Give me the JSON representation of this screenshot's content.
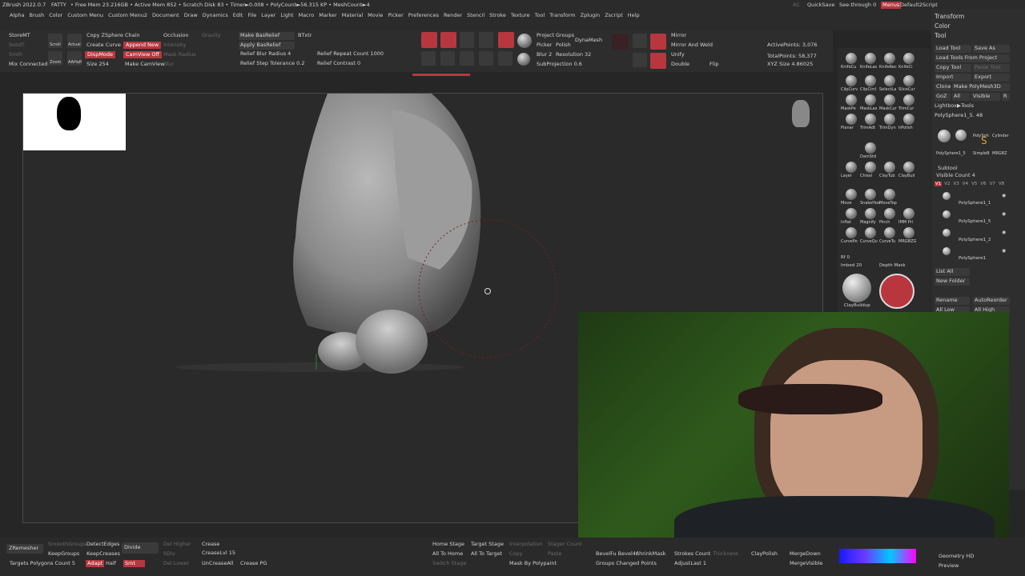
{
  "status": {
    "app_title": "ZBrush 2022.0.7",
    "doc": "FATTY",
    "stats": "• Free Mem 23.216GB • Active Mem 852 • Scratch Disk 83 • Timer►0.008 • PolyCount►56.315 KP • MeshCount►4",
    "ac": "AC",
    "quicksave": "QuickSave",
    "seethrough": "See-through 0",
    "menus_btn": "Menus",
    "script": "Default2Script"
  },
  "menus": [
    "Alpha",
    "Brush",
    "Color",
    "Custom Menu",
    "Custom Menu2",
    "Document",
    "Draw",
    "Dynamics",
    "Edit",
    "File",
    "Layer",
    "Light",
    "Macro",
    "Marker",
    "Material",
    "Movie",
    "Picker",
    "Preferences",
    "Render",
    "Stencil",
    "Stroke",
    "Texture",
    "Tool",
    "Transform",
    "Zplugin",
    "Zscript",
    "Help"
  ],
  "top_left": {
    "store_mt": "StoreMT",
    "solo": "SolidT",
    "smooth": "Smth",
    "mix": "Mix Connected I",
    "scroll": "Scroll",
    "actual": "Actual",
    "zoom": "Zoom",
    "aahalf": "AAHalf",
    "copy_chain": "Copy ZSphere Chain",
    "create_curve": "Create Curve",
    "dispmode": "DispMode",
    "size": "Size 254",
    "append_new": "Append New",
    "camview": "CamView Off",
    "make_camview": "Make CamView",
    "occlusion": "Occlusion",
    "intensity": "Intensity",
    "mask_radius": "Mask Radius",
    "blur": "Blur",
    "gravity": "Gravity"
  },
  "relief": {
    "make_basrelief": "Make BasRelief",
    "btxtr": "BTxtr",
    "apply_basrelief": "Apply BasRelief",
    "blur_radius": "Relief Blur Radius 4",
    "step_tolerance": "Relief Step Tolerance 0.2",
    "repeat_count": "Relief Repeat Count 1000",
    "contrast": "Relief Contrast 0"
  },
  "draw_tools": {
    "remesh_all": "Remesh All",
    "bpr": "BPR",
    "edit": "Edit",
    "draw": "Draw",
    "move": "Move",
    "scale": "Scale",
    "rotate": "Rotate",
    "line_fill": "Line Fill",
    "polyf": "PolyF",
    "transp": "Transp",
    "lsym": "L.Sym",
    "project": "Project",
    "groups": "Groups",
    "picker": "Picker",
    "polish": "Polish",
    "blur": "Blur 2",
    "resolution": "Resolution 32",
    "subprojection": "SubProjection 0.6",
    "dynamesh": "DynaMesh",
    "mirror": "Mirror",
    "mirror_weld": "Mirror And Weld",
    "unify": "Unify",
    "double": "Double",
    "flip": "Flip",
    "active_points": "ActivePoints: 3,076",
    "total_points": "TotalPoints: 58,377",
    "xyz_size": "XYZ Size 4.86025"
  },
  "brushes": {
    "row1": [
      "KnifeCu",
      "KnifeLas",
      "KnifeRec",
      "KnifeCi"
    ],
    "row2": [
      "ClipCurv",
      "ClipCircl",
      "SelectLa",
      "SliceCur"
    ],
    "row3": [
      "MaskPe",
      "MaskLas",
      "MaskCur",
      "TrimCur"
    ],
    "row4": [
      "Planar",
      "TrimAdt",
      "TrimDyn",
      "hPolish"
    ],
    "row5": [
      "DamStd"
    ],
    "row6": [
      "Layer",
      "Chisel",
      "ClayTub",
      "ClayBuil"
    ],
    "row7": [
      "Move",
      "SnakeHoo",
      "MoveTop"
    ],
    "row8": [
      "Inflat",
      "Magnify",
      "Pinch",
      "IMM Pri"
    ],
    "row9": [
      "CurvePo",
      "CurveQu",
      "CurveTu",
      "MRGBZG"
    ],
    "rf": "Rf 0",
    "imbed": "Imbed 20",
    "depth_mask": "Depth Mask",
    "current_brush": "ClayBuildup"
  },
  "tool_panel": {
    "transform": "Transform",
    "color": "Color",
    "tool": "Tool",
    "load_tool": "Load Tool",
    "save_as": "Save As",
    "load_from_project": "Load Tools From Project",
    "copy_tool": "Copy Tool",
    "paste_tool": "Paste Tool",
    "import": "Import",
    "export": "Export",
    "clone": "Clone",
    "make_polymesh": "Make PolyMesh3D",
    "goz": "GoZ",
    "all": "All",
    "visible": "Visible",
    "r": "R",
    "lightbox": "Lightbox▶Tools",
    "current_tool": "PolySphere1_5. 48",
    "thumbs": [
      "PolySph",
      "Cylinder",
      "SimpleB",
      "MRGBZ"
    ],
    "thumb_name": "PolySphere1_5",
    "subtool": "Subtool",
    "visible_count": "Visible Count 4",
    "levels": [
      "V1",
      "V2",
      "V3",
      "V4",
      "V5",
      "V6",
      "V7",
      "V8"
    ],
    "subtools": [
      "PolySphere1_1",
      "PolySphere1_5",
      "PolySphere1_2",
      "PolySphere1"
    ],
    "list_all": "List All",
    "new_folder": "New Folder",
    "rename": "Rename",
    "autoreorder": "AutoReorder",
    "all_low": "All Low",
    "all_high": "All High"
  },
  "bottom": {
    "zremesher": "ZRemesher",
    "smooth_groups": "SmoothGroups",
    "keep_groups": "KeepGroups",
    "target_polys": "Targets Polygons Count 5",
    "detect_edges": "DetectEdges",
    "keep_creases": "KeepCreases",
    "adapt": "Adapt",
    "half": "Half",
    "divide": "Divide",
    "smt": "Smt",
    "del_higher": "Del Higher",
    "sdiv": "SDiv",
    "del_lower": "Del Lower",
    "crease": "Crease",
    "crease_lvl": "CreaseLvl 15",
    "uncrease_all": "UnCreaseAll",
    "crease_pg": "Crease PG",
    "home_stage": "Home Stage",
    "target_stage": "Target Stage",
    "all_to_home": "All To Home",
    "all_to_target": "All To Target",
    "interpolation": "Interpolation",
    "copy": "Copy",
    "paste": "Paste",
    "switch_stage": "Switch Stage",
    "stager_count": "Stager Count",
    "mask_by_polypaint": "Mask By Polypaint",
    "bevel": "BevelFu Bevel4c",
    "shrink_mask": "ShrinkMask",
    "strokes_count": "Strokes Count",
    "thickness": "Thickness",
    "groups_changed": "Groups Changed Points",
    "adjust_last": "AdjustLast 1",
    "clay_polish": "ClayPolish",
    "merge_down": "MergeDown",
    "merge_visible": "MergeVisible",
    "geometry_hd": "Geometry HD",
    "preview": "Preview"
  },
  "colors": {
    "accent_red": "#b8373f",
    "bg": "#262626",
    "panel": "#2d2d2d"
  }
}
